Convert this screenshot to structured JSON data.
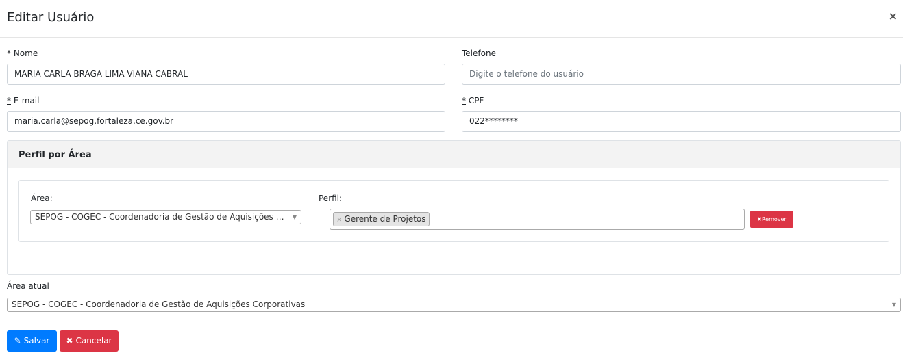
{
  "modal": {
    "title": "Editar Usuário",
    "close_icon": "×"
  },
  "form": {
    "nome": {
      "required_mark": "*",
      "label": " Nome",
      "value": "MARIA CARLA BRAGA LIMA VIANA CABRAL"
    },
    "telefone": {
      "label": "Telefone",
      "placeholder": "Digite o telefone do usuário"
    },
    "email": {
      "required_mark": "*",
      "label": " E-mail",
      "value": "maria.carla@sepog.fortaleza.ce.gov.br"
    },
    "cpf": {
      "required_mark": "*",
      "label": " CPF",
      "value": "022********"
    }
  },
  "perfil_panel": {
    "title": "Perfil por Área",
    "area_label": "Área:",
    "area_value": "SEPOG - COGEC - Coordenadoria de Gestão de Aquisições C...",
    "perfil_label": "Perfil:",
    "perfil_tags": [
      {
        "remove": "×",
        "label": "Gerente de Projetos"
      }
    ],
    "remove_button": {
      "icon": "✖",
      "label": "Remover"
    }
  },
  "area_atual": {
    "label": "Área atual",
    "value": "SEPOG - COGEC - Coordenadoria de Gestão de Aquisições Corporativas"
  },
  "actions": {
    "save": {
      "icon": "✎",
      "label": "Salvar"
    },
    "cancel": {
      "icon": "✖",
      "label": "Cancelar"
    }
  },
  "colors": {
    "primary": "#007bff",
    "danger": "#dc3545",
    "panel_header": "#f3f3f3"
  }
}
